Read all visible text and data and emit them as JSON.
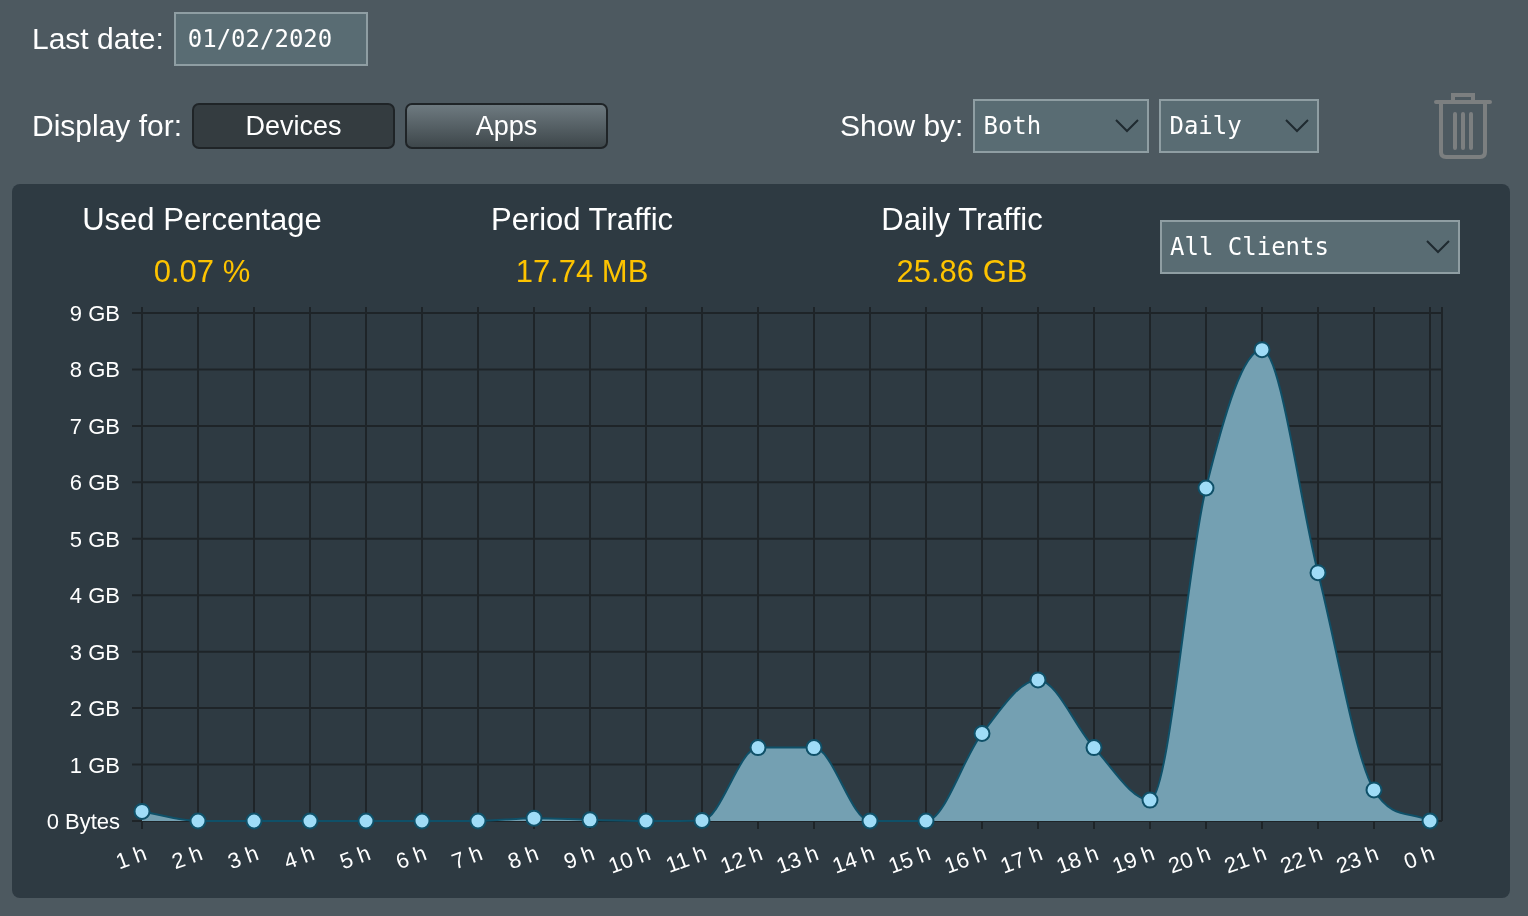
{
  "last_date": {
    "label": "Last date:",
    "value": "01/02/2020"
  },
  "display_for": {
    "label": "Display for:",
    "options": [
      {
        "label": "Devices",
        "selected": true
      },
      {
        "label": "Apps",
        "selected": false
      }
    ]
  },
  "show_by": {
    "label": "Show by:",
    "selects": [
      "Both",
      "Daily"
    ]
  },
  "stats": [
    {
      "label": "Used Percentage",
      "value": "0.07 %"
    },
    {
      "label": "Period Traffic",
      "value": "17.74 MB"
    },
    {
      "label": "Daily Traffic",
      "value": "25.86 GB"
    }
  ],
  "client_select": "All Clients",
  "chart_data": {
    "type": "area",
    "categories": [
      "1 h",
      "2 h",
      "3 h",
      "4 h",
      "5 h",
      "6 h",
      "7 h",
      "8 h",
      "9 h",
      "10 h",
      "11 h",
      "12 h",
      "13 h",
      "14 h",
      "15 h",
      "16 h",
      "17 h",
      "18 h",
      "19 h",
      "20 h",
      "21 h",
      "22 h",
      "23 h",
      "0 h"
    ],
    "ylim": [
      0,
      9
    ],
    "grid": true,
    "yticks": [
      {
        "value": 0,
        "label": "0 Bytes"
      },
      {
        "value": 1,
        "label": "1 GB"
      },
      {
        "value": 2,
        "label": "2 GB"
      },
      {
        "value": 3,
        "label": "3 GB"
      },
      {
        "value": 4,
        "label": "4 GB"
      },
      {
        "value": 5,
        "label": "5 GB"
      },
      {
        "value": 6,
        "label": "6 GB"
      },
      {
        "value": 7,
        "label": "7 GB"
      },
      {
        "value": 8,
        "label": "8 GB"
      },
      {
        "value": 9,
        "label": "9 GB"
      }
    ],
    "series": [
      {
        "color": "#74a0b2",
        "values": [
          0.17,
          0,
          0,
          0,
          0,
          0,
          0,
          0.05,
          0.02,
          0,
          0.01,
          1.3,
          1.3,
          0,
          0,
          1.55,
          2.5,
          1.3,
          0.37,
          5.9,
          8.35,
          4.4,
          0.55,
          0
        ]
      }
    ]
  }
}
